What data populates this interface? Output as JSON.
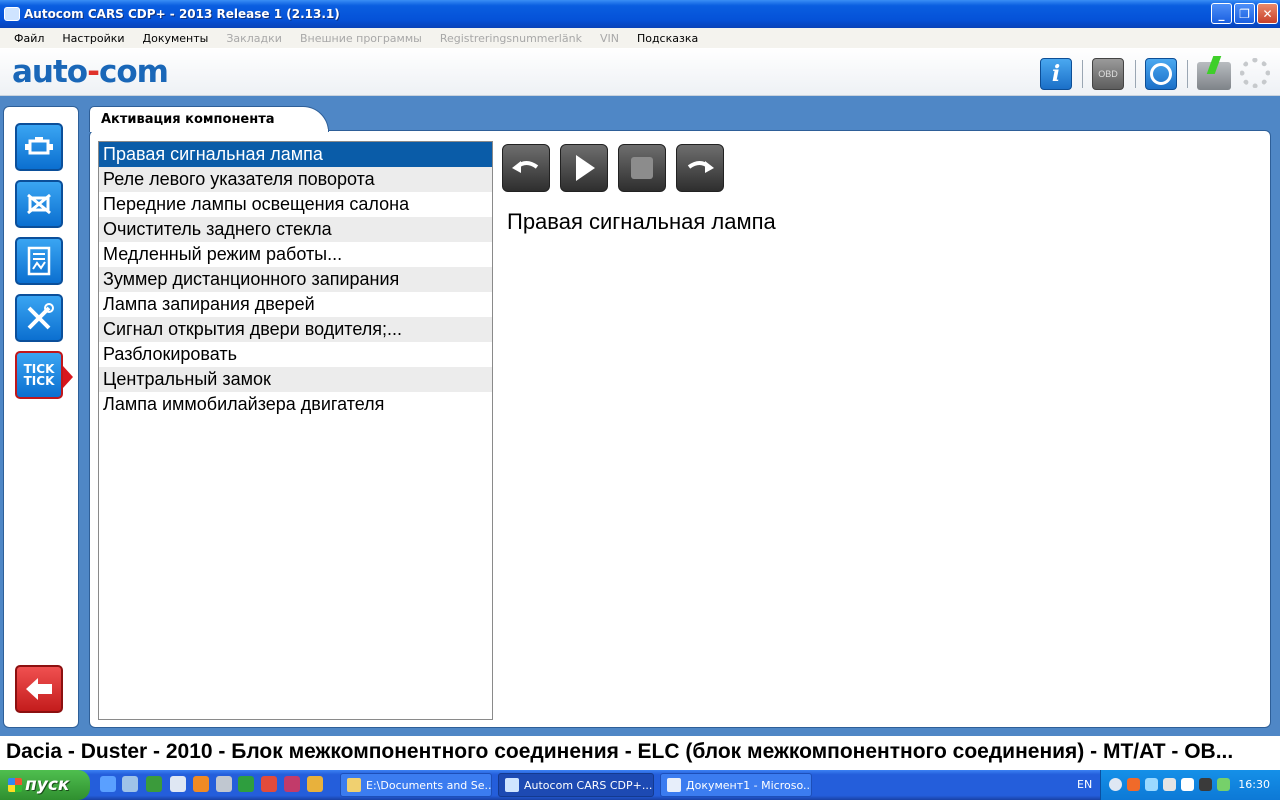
{
  "window": {
    "title": "Autocom CARS CDP+ - 2013 Release 1 (2.13.1)",
    "minimize": "_",
    "maximize": "❐",
    "close": "✕"
  },
  "menu": {
    "items": [
      {
        "label": "Файл",
        "enabled": true
      },
      {
        "label": "Настройки",
        "enabled": true
      },
      {
        "label": "Документы",
        "enabled": true
      },
      {
        "label": "Закладки",
        "enabled": false
      },
      {
        "label": "Внешние программы",
        "enabled": false
      },
      {
        "label": "Registreringsnummerlänk",
        "enabled": false
      },
      {
        "label": "VIN",
        "enabled": false
      },
      {
        "label": "Подсказка",
        "enabled": true
      }
    ]
  },
  "logo": {
    "left": "auto",
    "dash": "-",
    "right": "com"
  },
  "toolbar": {
    "info_label": "i",
    "obd_label": "OBD",
    "icons": [
      "info-icon",
      "obd-icon",
      "help-icon",
      "battery-icon",
      "spinner-icon"
    ]
  },
  "nav": {
    "buttons": [
      "engine-icon",
      "clear-fault-icon",
      "datasheet-icon",
      "tools-icon",
      "tick-tick-icon"
    ],
    "tick_line1": "TICK",
    "tick_line2": "TICK",
    "back": "back-arrow-icon"
  },
  "tab": {
    "label": "Активация компонента"
  },
  "components": [
    "Правая сигнальная лампа",
    "Реле левого указателя поворота",
    "Передние лампы освещения салона",
    "Очиститель заднего стекла",
    "Медленный  режим  работы...",
    "Зуммер дистанционного запирания",
    "Лампа запирания дверей",
    "Сигнал  открытия  двери  водителя;...",
    "Разблокировать",
    "Центральный замок",
    "Лампа иммобилайзера двигателя"
  ],
  "selected_index": 0,
  "controls": [
    "undo-icon",
    "play-icon",
    "stop-icon",
    "redo-icon"
  ],
  "detail": {
    "title": "Правая сигнальная лампа"
  },
  "status": {
    "vehicle": "Dacia - Duster - 2010 - Блок межкомпонентного соединения - ELC (блок межкомпонентного соединения) - MT/AT - OB..."
  },
  "taskbar": {
    "start": "пуск",
    "tasks": [
      {
        "label": "E:\\Documents and Se...",
        "active": false
      },
      {
        "label": "Autocom CARS CDP+...",
        "active": true
      },
      {
        "label": "Документ1 - Microso...",
        "active": false
      }
    ],
    "lang": "EN",
    "clock": "16:30"
  }
}
